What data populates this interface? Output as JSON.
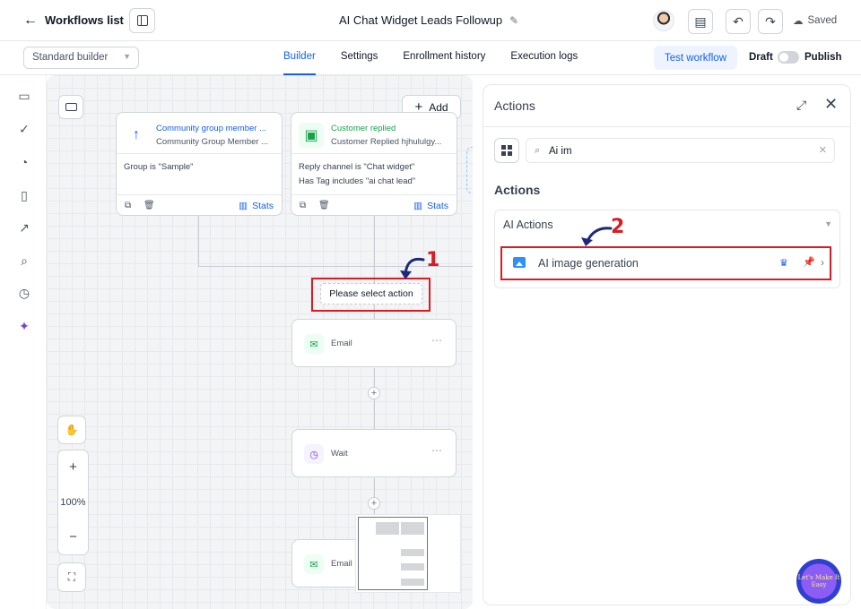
{
  "header": {
    "back_label": "Workflows list",
    "workflow_title": "AI Chat Widget Leads Followup",
    "saved_label": "Saved"
  },
  "subbar": {
    "builder_select": "Standard builder",
    "tabs": [
      {
        "label": "Builder",
        "active": true
      },
      {
        "label": "Settings"
      },
      {
        "label": "Enrollment history"
      },
      {
        "label": "Execution logs"
      }
    ],
    "test_button": "Test workflow",
    "draft_label": "Draft",
    "publish_label": "Publish"
  },
  "canvas": {
    "add_button": "Add",
    "triggers": [
      {
        "name": "Community group member ...",
        "subtitle": "Community Group Member ...",
        "conditions": [
          "Group is \"Sample\""
        ],
        "stats_label": "Stats",
        "icon": "arrow-up-icon",
        "accent": "#155eef"
      },
      {
        "name": "Customer replied",
        "subtitle": "Customer Replied hjhululgy...",
        "conditions": [
          "Reply channel is \"Chat widget\"",
          "Has Tag includes \"ai chat lead\""
        ],
        "stats_label": "Stats",
        "icon": "chat-icon",
        "accent": "#16a34a"
      }
    ],
    "select_action_label": "Please select action",
    "nodes": [
      {
        "label": "Email",
        "icon": "email-icon",
        "color": "#16a34a"
      },
      {
        "label": "Wait",
        "icon": "clock-icon",
        "color": "#7c3aed"
      },
      {
        "label": "Email",
        "icon": "email-icon",
        "color": "#16a34a"
      }
    ],
    "zoom_level": "100%"
  },
  "actions_panel": {
    "title": "Actions",
    "search_value": "Ai im",
    "section_title": "Actions",
    "group_title": "AI Actions",
    "item_label": "AI image generation"
  },
  "annotations": {
    "step_1": "1",
    "step_2": "2",
    "accent_color": "#d91c24"
  },
  "logo_text": "Let's Make It Easy"
}
